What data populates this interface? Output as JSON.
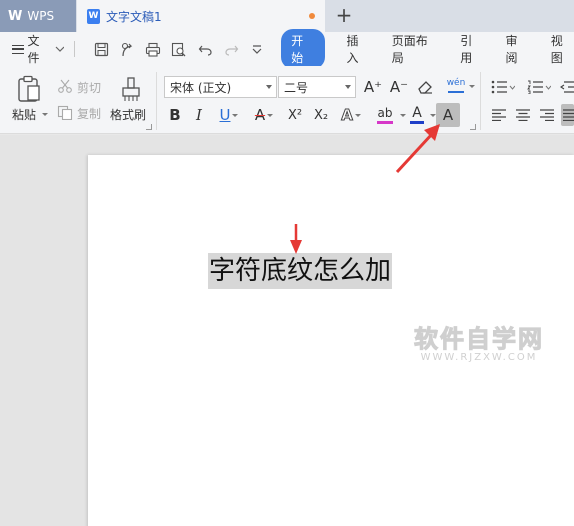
{
  "tabs": {
    "app_logo": "W",
    "app_label": "WPS",
    "document_icon": "W",
    "document_title": "文字文稿1",
    "new_tab": "+"
  },
  "menu": {
    "file_label": "文件",
    "ribbon_tabs": [
      "开始",
      "插入",
      "页面布局",
      "引用",
      "审阅",
      "视图"
    ],
    "active_tab": "开始"
  },
  "ribbon": {
    "paste_label": "粘贴",
    "cut_label": "剪切",
    "copy_label": "复制",
    "format_painter_label": "格式刷",
    "font_name": "宋体 (正文)",
    "font_size": "二号",
    "bold": "B",
    "italic": "I",
    "underline": "U",
    "strikethrough": "A",
    "superscript": "X²",
    "subscript": "X₂",
    "text_effect": "A",
    "highlight": "ab",
    "font_color": "A",
    "char_shading": "A",
    "grow_font": "A⁺",
    "shrink_font": "A⁻",
    "phonetic": "wén"
  },
  "document": {
    "text": "字符底纹怎么加",
    "watermark_main": "软件自学网",
    "watermark_sub": "WWW.RJZXW.COM"
  },
  "colors": {
    "active_tab": "#3f7fe0",
    "annotation_arrow": "#e53935",
    "char_shading": "#d7d7d7",
    "wps_tab": "#8a9bb7"
  }
}
